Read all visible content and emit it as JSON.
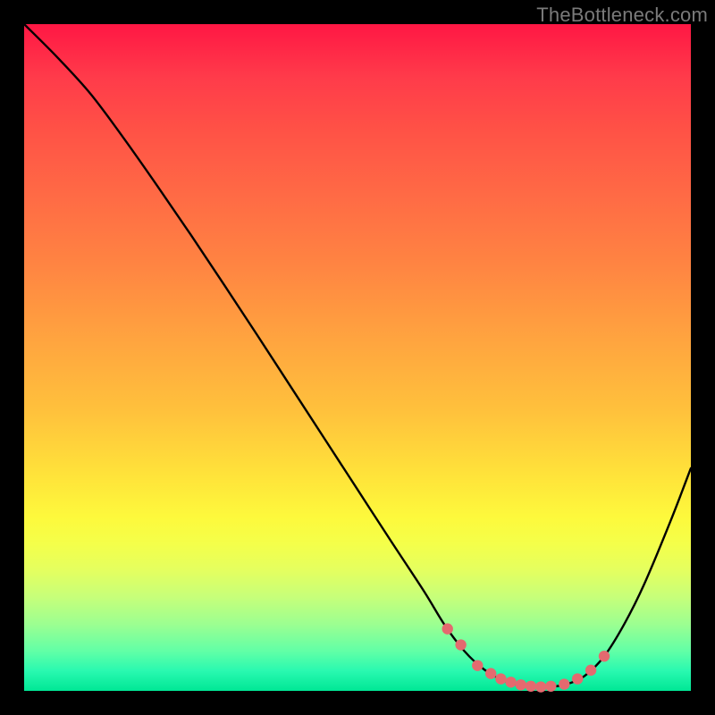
{
  "watermark": "TheBottleneck.com",
  "colors": {
    "background": "#000000",
    "curve_stroke": "#000000",
    "marker_fill": "#e46a6f",
    "gradient_top": "#ff1744",
    "gradient_bottom": "#00e795"
  },
  "chart_data": {
    "type": "line",
    "title": "",
    "xlabel": "",
    "ylabel": "",
    "xlim": [
      0,
      100
    ],
    "ylim": [
      0,
      100
    ],
    "grid": false,
    "legend": false,
    "series": [
      {
        "name": "bottleneck-curve",
        "x": [
          0,
          5,
          10,
          15,
          20,
          25,
          30,
          35,
          40,
          45,
          50,
          55,
          60,
          63,
          66,
          69,
          72,
          75,
          78,
          81,
          84,
          87,
          90,
          93,
          97,
          100
        ],
        "y": [
          100,
          95,
          89.5,
          82.8,
          75.7,
          68.4,
          60.9,
          53.3,
          45.6,
          37.9,
          30.2,
          22.5,
          14.9,
          10.0,
          6.0,
          3.2,
          1.5,
          0.7,
          0.6,
          0.9,
          2.2,
          5.2,
          10.0,
          16.0,
          25.6,
          33.4
        ]
      }
    ],
    "markers": {
      "name": "optimal-range",
      "x": [
        63.5,
        65.5,
        68,
        70,
        71.5,
        73,
        74.5,
        76,
        77.5,
        79,
        81,
        83,
        85,
        87
      ],
      "y": [
        9.3,
        6.9,
        3.8,
        2.6,
        1.8,
        1.3,
        0.9,
        0.7,
        0.6,
        0.7,
        1.0,
        1.8,
        3.1,
        5.2
      ]
    }
  }
}
